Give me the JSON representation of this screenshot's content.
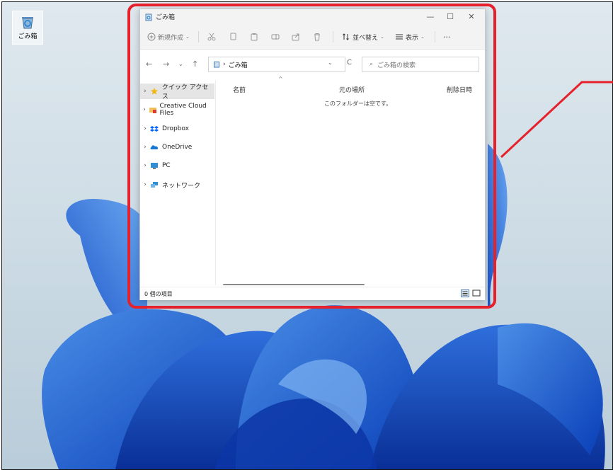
{
  "desktop": {
    "recycle_bin_label": "ごみ箱"
  },
  "window": {
    "title": "ごみ箱",
    "controls": {
      "minimize": "—",
      "maximize": "☐",
      "close": "✕"
    }
  },
  "toolbar": {
    "new_label": "新規作成",
    "sort_label": "並べ替え",
    "view_label": "表示",
    "more_label": "···"
  },
  "address": {
    "separator": "›",
    "location": "ごみ箱",
    "refresh": "C",
    "search_placeholder": "ごみ箱の検索"
  },
  "nav_pane": {
    "items": [
      {
        "label": "クイック アクセス",
        "icon": "star-icon"
      },
      {
        "label": "Creative Cloud Files",
        "icon": "creative-cloud-folder-icon"
      },
      {
        "label": "Dropbox",
        "icon": "dropbox-icon"
      },
      {
        "label": "OneDrive",
        "icon": "onedrive-cloud-icon"
      },
      {
        "label": "PC",
        "icon": "monitor-icon"
      },
      {
        "label": "ネットワーク",
        "icon": "network-icon"
      }
    ]
  },
  "content": {
    "columns": [
      "名前",
      "元の場所",
      "削除日時"
    ],
    "empty_message": "このフォルダーは空です。"
  },
  "status": {
    "item_count": "0 個の項目"
  },
  "colors": {
    "highlight_border": "#e5212b",
    "accent": "#0067c0"
  }
}
